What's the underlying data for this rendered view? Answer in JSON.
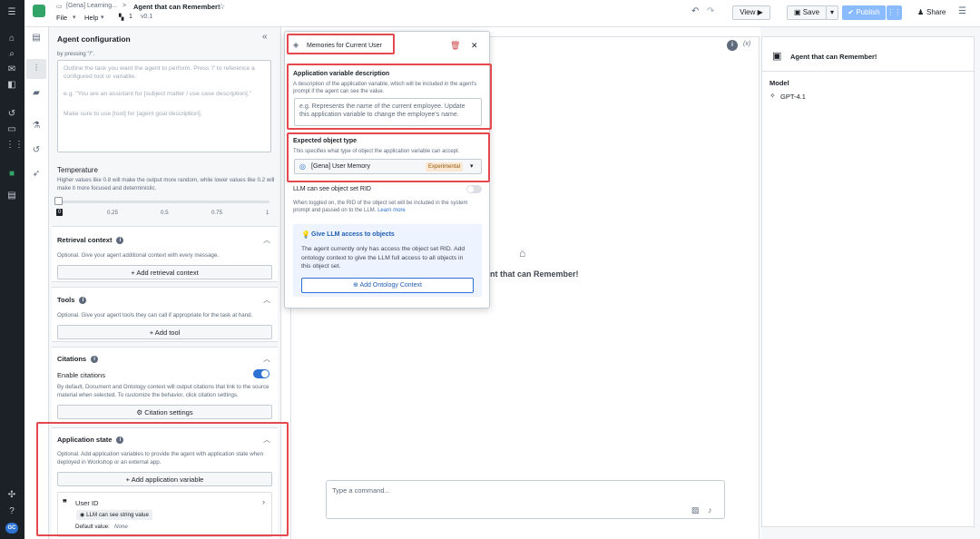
{
  "topbar": {
    "breadcrumb_parent": "[Gena] Learning...",
    "separator": ">",
    "title": "Agent that can Remember!",
    "menu_file": "File",
    "menu_help": "Help",
    "count": "1",
    "version": "v0.1",
    "view_label": "View",
    "save_label": "Save",
    "publish_label": "Publish",
    "share_label": "Share"
  },
  "config": {
    "title": "Agent configuration",
    "pressing_hint": "by pressing \"/\".",
    "prompt_line1": "Outline the task you want the agent to perform. Press '/' to reference a configured tool or variable.",
    "prompt_line2": "e.g. \"You are an assistant for [subject matter / use case description].\"",
    "prompt_line3": "Make sure to use [tool] for [agent goal description].",
    "temperature_title": "Temperature",
    "temperature_desc": "Higher values like 0.8 will make the output more random, while lower values like 0.2 will make it more focused and deterministic.",
    "temperature_value": "0",
    "temperature_fraction": 0,
    "ticks": [
      "0.25",
      "0.5",
      "0.75",
      "1"
    ],
    "retrieval": {
      "title": "Retrieval context",
      "desc": "Optional. Give your agent additional context with every message.",
      "button": "Add retrieval context"
    },
    "tools": {
      "title": "Tools",
      "desc": "Optional. Give your agent tools they can call if appropriate for the task at hand.",
      "button": "Add tool"
    },
    "citations": {
      "title": "Citations",
      "enable_label": "Enable citations",
      "desc": "By default, Document and Ontology context will output citations that link to the source material when selected. To customize the behavior, click citation settings.",
      "button": "Citation settings"
    },
    "app_state": {
      "title": "Application state",
      "desc": "Optional. Add application variables to provide the agent with application state when deployed in Workshop or an external app.",
      "button": "Add application variable",
      "var_name": "User ID",
      "var_tag": "LLM can see string value",
      "default_label": "Default value:",
      "default_value": "None"
    }
  },
  "popover": {
    "title": "Memories for Current User",
    "desc_label": "Application variable description",
    "desc_help": "A description of the application variable, which will be included in the agent's prompt if the agent can see the value.",
    "desc_placeholder": "e.g. Represents the name of the current employee. Update this application variable to change the employee's name.",
    "type_label": "Expected object type",
    "type_help": "This specifies what type of object the application variable can accept.",
    "type_value": "[Gena] User Memory",
    "type_badge": "Experimental",
    "rid_label": "LLM can see object set RID",
    "rid_help": "When toggled on, the RID of the object set will be included in the system prompt and passed on to the LLM.",
    "rid_link": "Learn more",
    "callout_title": "Give LLM access to objects",
    "callout_body": "The agent currently only has access the object set RID. Add ontology context to give the LLM full access to all objects in this object set.",
    "callout_button": "Add Ontology Context"
  },
  "main": {
    "agent_name_partial": "nt that can Remember!",
    "variable_icon_text": "(x)",
    "command_placeholder": "Type a command..."
  },
  "right": {
    "title": "Agent that can Remember!",
    "model_label": "Model",
    "model_value": "GPT-4.1"
  },
  "rail": {
    "user_initials": "GC"
  },
  "colors": {
    "accent": "#2d72d2",
    "highlight": "#e5484d",
    "publish": "#8abbff",
    "danger": "#cd4246",
    "badge_bg": "#fbe8d2",
    "badge_text": "#935610"
  }
}
